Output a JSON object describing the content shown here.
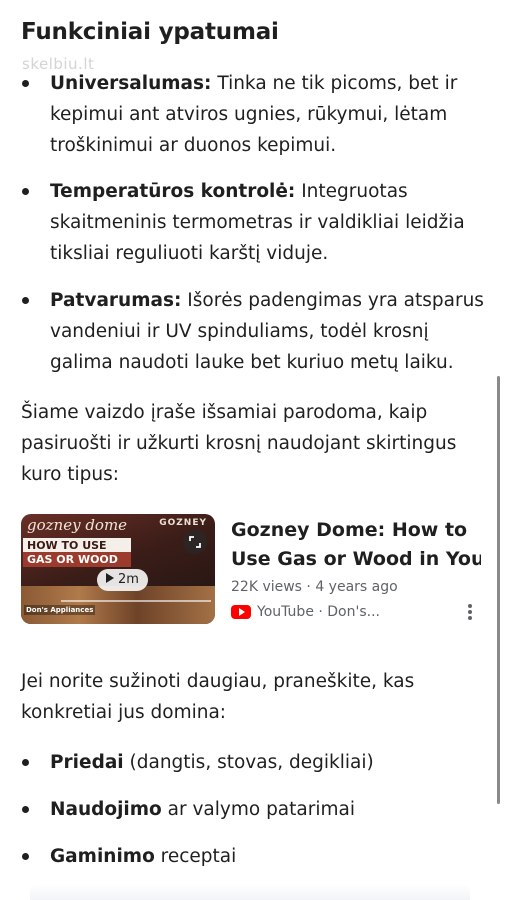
{
  "heading": "Funkciniai ypatumai",
  "watermark": "skelbiu.lt",
  "features": [
    {
      "bold": "Universalumas:",
      "text": " Tinka ne tik picoms, bet ir kepimui ant atviros ugnies, rūkymui, lėtam troškinimui ar duonos kepimui."
    },
    {
      "bold": "Temperatūros kontrolė:",
      "text": " Integruotas skaitmeninis termometras ir valdikliai leidžia tiksliai reguliuoti karštį viduje."
    },
    {
      "bold": "Patvarumas:",
      "text": " Išorės padengimas yra atsparus vandeniui ir UV spinduliams, todėl krosnį galima naudoti lauke bet kuriuo metų laiku."
    }
  ],
  "intro_video": "Šiame vaizdo įraše išsamiai parodoma, kaip pasiruošti ir užkurti krosnį naudojant skirtingus kuro tipus:",
  "video": {
    "title_line1": "Gozney Dome: How to",
    "title_line2": "Use Gas or Wood in You...",
    "meta": "22K views · 4 years ago",
    "source": "YouTube · Don's...",
    "duration": "2m",
    "thumb_script": "gozney dome",
    "thumb_brand": "GOZNEY",
    "thumb_line1": "HOW  TO  USE",
    "thumb_line2": "GAS OR WOOD",
    "thumb_stamp": "Don's Appliances",
    "accent_color": "#ff0000"
  },
  "followup": "Jei norite sužinoti daugiau, praneškite, kas konkretiai jus domina:",
  "topics": [
    {
      "bold": "Priedai",
      "text": " (dangtis, stovas, degikliai)"
    },
    {
      "bold": "Naudojimo",
      "text": " ar valymo patarimai"
    },
    {
      "bold": "Gaminimo",
      "text": " receptai"
    }
  ]
}
